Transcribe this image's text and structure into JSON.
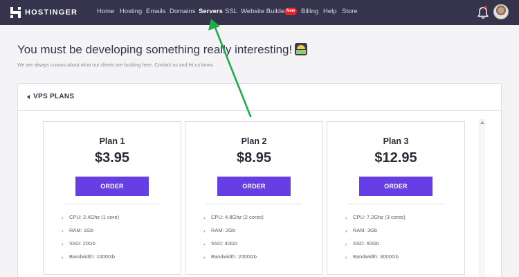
{
  "nav": {
    "brand": "HOSTINGER",
    "items": [
      "Home",
      "Hosting",
      "Emails",
      "Domains",
      "Servers",
      "SSL",
      "Website Builder",
      "Billing",
      "Help",
      "Store"
    ],
    "active": "Servers",
    "new_badge": "New"
  },
  "page": {
    "title": "You must be developing something really interesting!",
    "subtitle": "We are always curious about what our clients are building here. Contact us and let us know."
  },
  "panel": {
    "title": "VPS PLANS"
  },
  "plans": [
    {
      "name": "Plan 1",
      "price": "$3.95",
      "order_label": "ORDER",
      "features": [
        "CPU: 2.4Ghz (1 core)",
        "RAM: 1Gb",
        "SSD: 20Gb",
        "Bandwidth: 1000Gb"
      ]
    },
    {
      "name": "Plan 2",
      "price": "$8.95",
      "order_label": "ORDER",
      "features": [
        "CPU: 4.8Ghz (2 cores)",
        "RAM: 2Gb",
        "SSD: 40Gb",
        "Bandwidth: 2000Gb"
      ]
    },
    {
      "name": "Plan 3",
      "price": "$12.95",
      "order_label": "ORDER",
      "features": [
        "CPU: 7.2Ghz (3 cores)",
        "RAM: 3Gb",
        "SSD: 60Gb",
        "Bandwidth: 3000Gb"
      ]
    }
  ],
  "colors": {
    "nav_bg": "#36344d",
    "accent": "#673de6",
    "badge": "#e3242b",
    "annotation": "#1faa4b"
  },
  "icons": {
    "logo": "hostinger-logo-icon",
    "bell": "bell-icon",
    "avatar": "user-avatar",
    "back": "chevron-left-icon",
    "feature_bullet": "chevron-right-icon"
  }
}
